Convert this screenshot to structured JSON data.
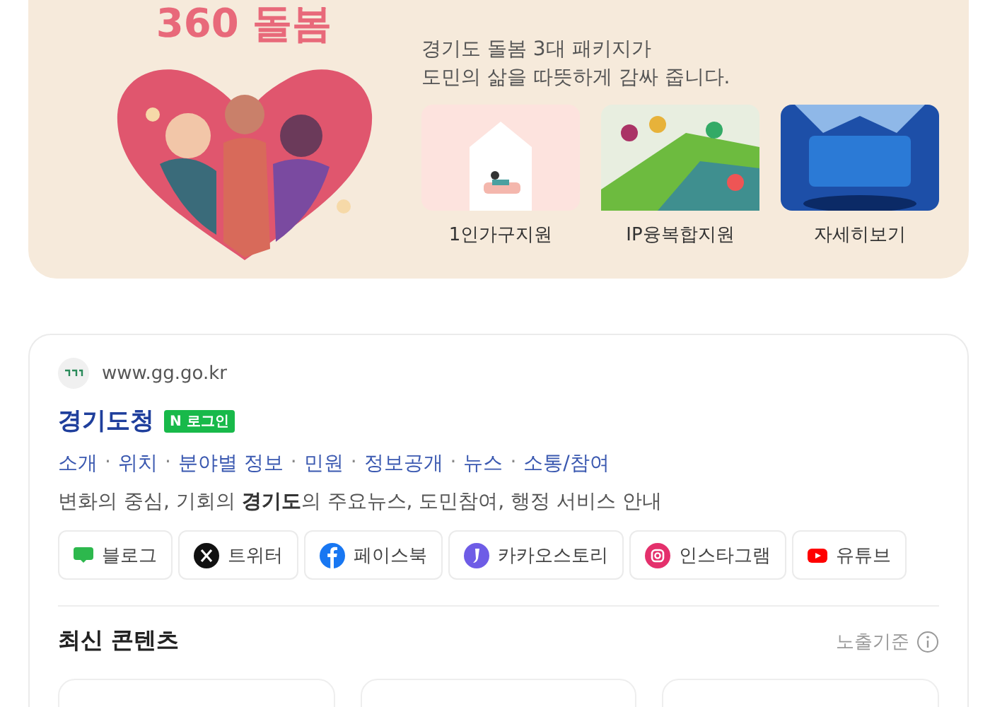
{
  "banner": {
    "logo_text": "360 돌봄",
    "subtitle_lines": [
      "경기도 돌봄 3대 패키지가",
      "도민의 삶을 따뜻하게 감싸 줍니다."
    ],
    "tiles": [
      {
        "kind": "house",
        "label": "1인가구지원"
      },
      {
        "kind": "crowd",
        "label": "IP융복합지원"
      },
      {
        "kind": "stage",
        "label": "자세히보기"
      }
    ]
  },
  "result": {
    "url": "www.gg.go.kr",
    "title": "경기도청",
    "badge": "N 로그인",
    "link_separator": "·",
    "links": [
      "소개",
      "위치",
      "분야별 정보",
      "민원",
      "정보공개",
      "뉴스",
      "소통/참여"
    ],
    "description": "변화의 중심, 기회의 **경기도**의 주요뉴스, 도민참여, 행정 서비스 안내",
    "socials": [
      {
        "kind": "blog",
        "label": "블로그"
      },
      {
        "kind": "x",
        "label": "트위터"
      },
      {
        "kind": "facebook",
        "label": "페이스북"
      },
      {
        "kind": "kakao",
        "label": "카카오스토리"
      },
      {
        "kind": "instagram",
        "label": "인스타그램"
      },
      {
        "kind": "youtube",
        "label": "유튜브"
      }
    ],
    "section_title": "최신 콘텐츠",
    "sort_label": "노출기준"
  }
}
